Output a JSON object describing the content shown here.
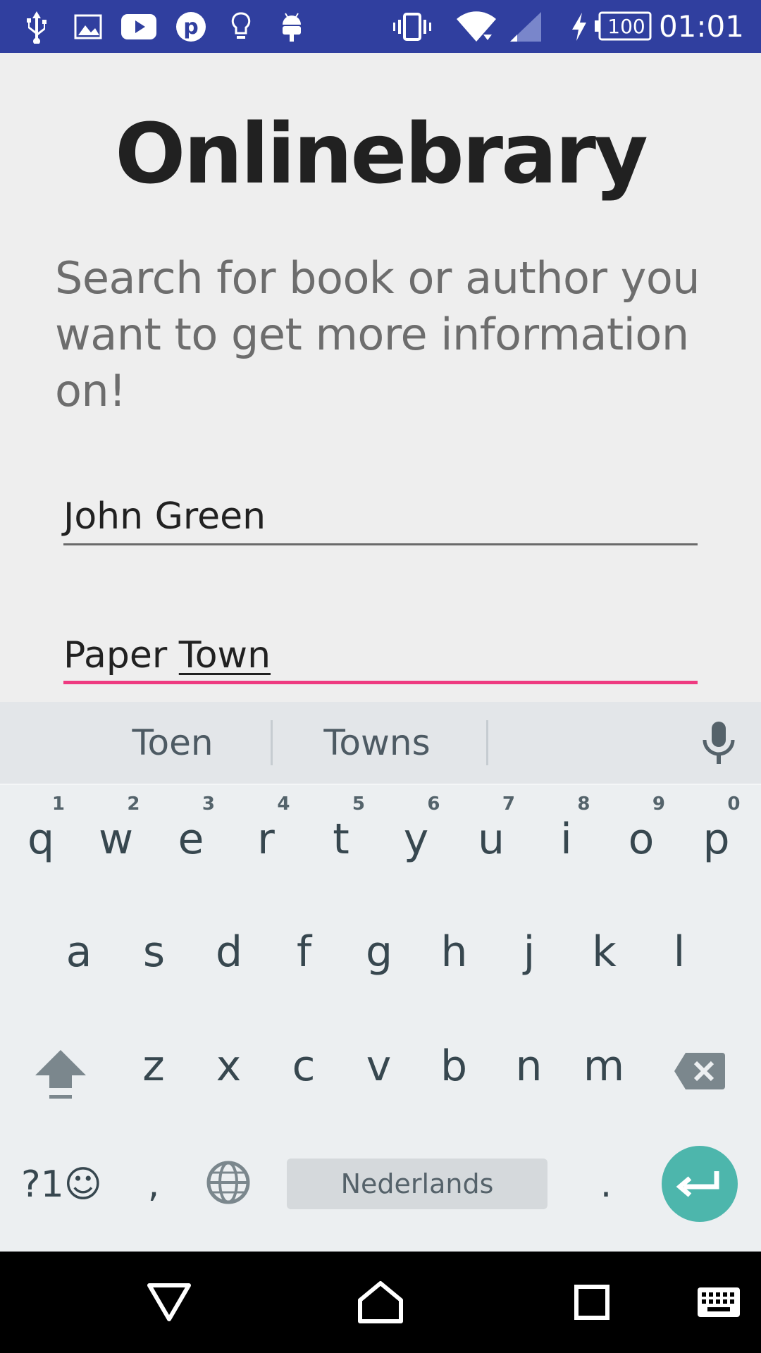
{
  "status_bar": {
    "time": "01:01",
    "battery": "100",
    "icons": [
      "usb-icon",
      "image-icon",
      "youtube-icon",
      "pinterest-icon",
      "lightbulb-icon",
      "android-icon",
      "vibrate-icon",
      "wifi-icon",
      "signal-icon",
      "charging-icon",
      "battery-icon"
    ]
  },
  "app": {
    "title": "Onlinebrary",
    "subtitle": "Search for book or author you want to get more information on!"
  },
  "fields": {
    "author": {
      "value": "John Green"
    },
    "book": {
      "value_plain": "Paper ",
      "value_composing": "Town"
    }
  },
  "keyboard": {
    "suggestions": [
      "Toen",
      "Towns"
    ],
    "row1": [
      {
        "ch": "q",
        "num": "1"
      },
      {
        "ch": "w",
        "num": "2"
      },
      {
        "ch": "e",
        "num": "3"
      },
      {
        "ch": "r",
        "num": "4"
      },
      {
        "ch": "t",
        "num": "5"
      },
      {
        "ch": "y",
        "num": "6"
      },
      {
        "ch": "u",
        "num": "7"
      },
      {
        "ch": "i",
        "num": "8"
      },
      {
        "ch": "o",
        "num": "9"
      },
      {
        "ch": "p",
        "num": "0"
      }
    ],
    "row2": [
      "a",
      "s",
      "d",
      "f",
      "g",
      "h",
      "j",
      "k",
      "l"
    ],
    "row3": [
      "z",
      "x",
      "c",
      "v",
      "b",
      "n",
      "m"
    ],
    "symbols_label": "?1☺",
    "comma": ",",
    "period": ".",
    "space_label": "Nederlands",
    "colors": {
      "enter": "#4db6ac",
      "accent": "#ee3a80",
      "status_bar": "#303f9f"
    }
  }
}
